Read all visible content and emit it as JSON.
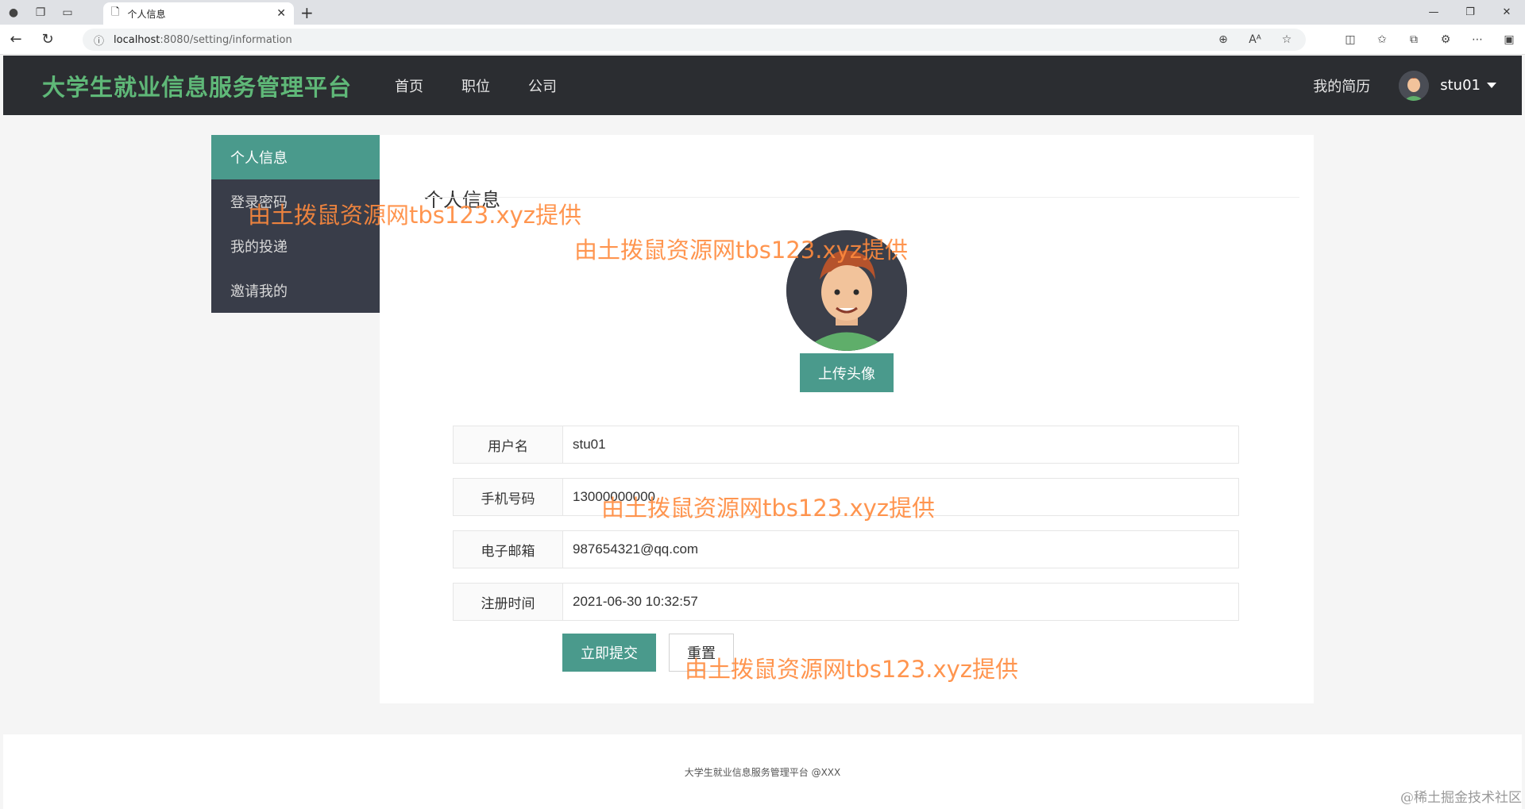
{
  "browser": {
    "tab_title": "个人信息",
    "url_host": "localhost",
    "url_path": ":8080/setting/information"
  },
  "navbar": {
    "brand": "大学生就业信息服务管理平台",
    "links": [
      "首页",
      "职位",
      "公司"
    ],
    "resume_link": "我的简历",
    "username": "stu01"
  },
  "sidebar": {
    "items": [
      {
        "label": "个人信息"
      },
      {
        "label": "登录密码"
      },
      {
        "label": "我的投递"
      },
      {
        "label": "邀请我的"
      }
    ]
  },
  "main": {
    "title": "个人信息",
    "upload_label": "上传头像",
    "fields": [
      {
        "label": "用户名",
        "value": "stu01"
      },
      {
        "label": "手机号码",
        "value": "13000000000"
      },
      {
        "label": "电子邮箱",
        "value": "987654321@qq.com"
      },
      {
        "label": "注册时间",
        "value": "2021-06-30 10:32:57"
      }
    ],
    "submit_label": "立即提交",
    "reset_label": "重置"
  },
  "footer": {
    "text": "大学生就业信息服务管理平台 @XXX",
    "corner_mark": "@稀土掘金技术社区"
  },
  "watermark": {
    "text": "由土拨鼠资源网tbs123.xyz提供"
  },
  "colors": {
    "brand": "#5fb878",
    "accent": "#4a9a8c",
    "navbar_bg": "#2b2d31",
    "sidebar_bg": "#393d49",
    "watermark": "#ff8a3d"
  }
}
